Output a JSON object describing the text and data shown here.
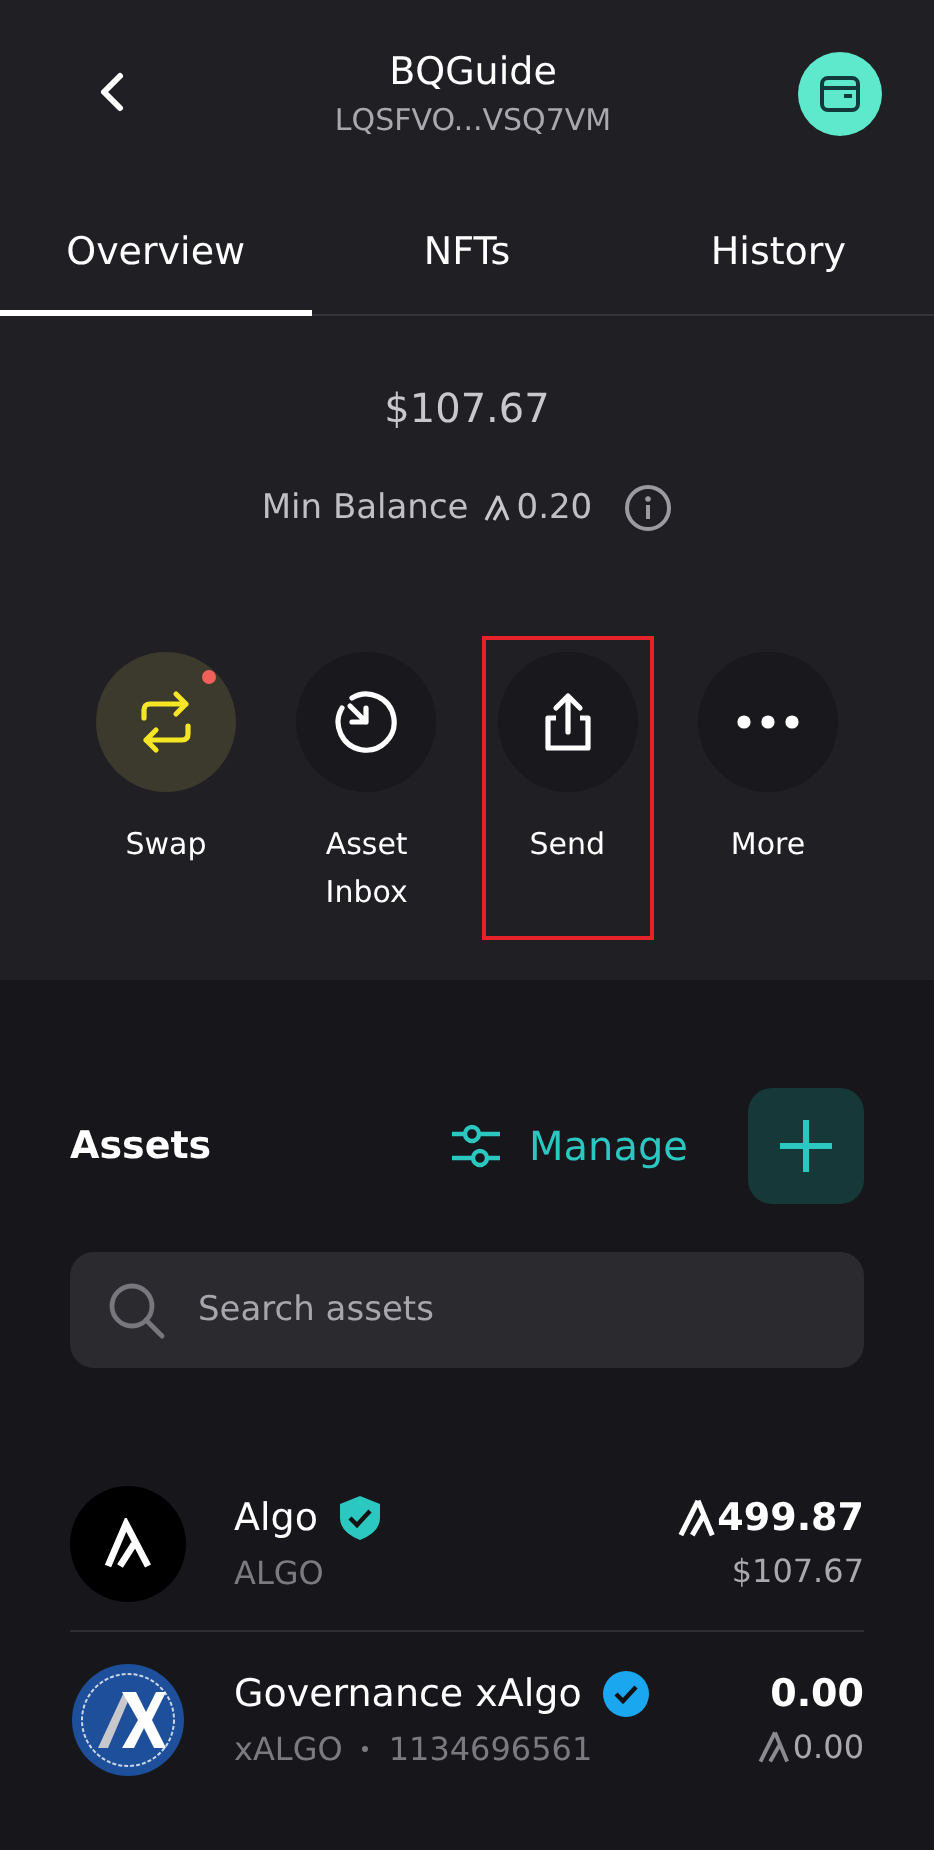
{
  "header": {
    "title": "BQGuide",
    "address": "LQSFVO...VSQ7VM"
  },
  "tabs": [
    {
      "label": "Overview",
      "selected": true
    },
    {
      "label": "NFTs",
      "selected": false
    },
    {
      "label": "History",
      "selected": false
    }
  ],
  "balance": {
    "value": "$107.67",
    "min_label": "Min Balance",
    "min_value": "0.20"
  },
  "actions": [
    {
      "kind": "swap",
      "label": "Swap",
      "notification": true,
      "highlighted": false
    },
    {
      "kind": "inbox",
      "label": "Asset Inbox",
      "notification": false,
      "highlighted": false
    },
    {
      "kind": "send",
      "label": "Send",
      "notification": false,
      "highlighted": true
    },
    {
      "kind": "more",
      "label": "More",
      "notification": false,
      "highlighted": false
    }
  ],
  "assets": {
    "title": "Assets",
    "manage": "Manage",
    "search": {
      "placeholder": "Search assets"
    },
    "items": [
      {
        "kind": "algo",
        "name": "Algo",
        "color": "#2cc7c0",
        "subtitle": "ALGO",
        "amount": "499.87",
        "amount_algo": true,
        "value": "$107.67",
        "value_algo": false
      },
      {
        "kind": "xalgo",
        "name": "Governance xAlgo",
        "color": "#1aa7f0",
        "subtitle": "xALGO",
        "id": "1134696561",
        "amount": "0.00",
        "amount_algo": false,
        "value": "0.00",
        "value_algo": true
      }
    ]
  }
}
